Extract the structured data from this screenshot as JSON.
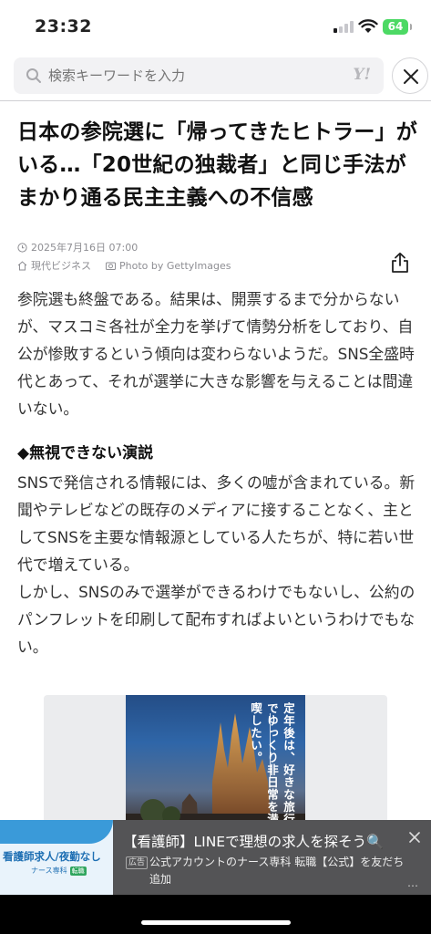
{
  "status_bar": {
    "time": "23:32",
    "battery": "64",
    "icons": [
      "cellular-signal-icon",
      "wifi-icon",
      "battery-icon"
    ]
  },
  "header": {
    "search_placeholder": "検索キーワードを入力",
    "logo_text": "Y!",
    "close_icon": "close-icon"
  },
  "article": {
    "title": "日本の参院選に「帰ってきたヒトラー」がいる…「20世紀の独裁者」と同じ手法がまかり通る民主主義への不信感",
    "date": "2025年7月16日 07:00",
    "source": "現代ビジネス",
    "photo_credit": "Photo by GettyImages",
    "paragraph1": "参院選も終盤である。結果は、開票するまで分からないが、マスコミ各社が全力を挙げて情勢分析をしており、自公が惨敗するという傾向は変わらないようだ。SNS全盛時代とあって、それが選挙に大きな影響を与えることは間違いない。",
    "section_heading": "◆無視できない演説",
    "paragraph2_line1": "SNSで発信される情報には、多くの嘘が含まれている。新聞やテレビなどの既存のメディアに接することなく、主としてSNSを主要な情報源としている人たちが、特に若い世代で増えている。",
    "paragraph2_line2": "しかし、SNSのみで選挙ができるわけでもないし、公約のパンフレットを印刷して配布すればよいというわけでもない。"
  },
  "inline_ad": {
    "text": "定年後は、好きな旅行でゆっくり非日常を満喫したい。"
  },
  "banner_ad": {
    "thumb_title": "看護師求人/夜勤なし",
    "thumb_sub": "ナース専科",
    "thumb_tag": "転職",
    "title": "【看護師】LINEで理想の求人を探そう🔍",
    "ad_label": "広告",
    "description": "公式アカウントのナース専科 転職【公式】を友だち追加",
    "more": "…"
  },
  "colors": {
    "battery": "#4cd964",
    "banner_bg": "#545456",
    "thumb_blue": "#3a9ad9"
  }
}
